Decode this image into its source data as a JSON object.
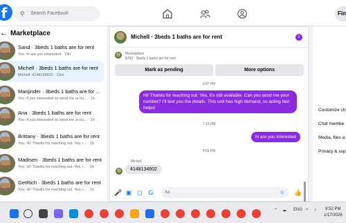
{
  "topbar": {
    "logo": "f",
    "search_placeholder": "Search Facebook",
    "icons": [
      "home-icon",
      "groups-icon",
      "profile-icon"
    ],
    "user": "Fin"
  },
  "left": {
    "title": "Marketplace",
    "conversations": [
      {
        "name": "Sand · 3beds 1 baths are for rent",
        "preview": "You: hi are you interested · 15h"
      },
      {
        "name": "Michell · 3beds 1 baths are for rent",
        "preview": "Michell: 4148134602 · 23m"
      },
      {
        "name": "Manjinder · 3beds 1 baths are for ...",
        "preview": "You: if you interested so send me ur nu... · 1h"
      },
      {
        "name": "Ana · 3beds 1 baths are for rent",
        "preview": "You: if you interested so send me ur nu... · 1h"
      },
      {
        "name": "Brittany · 3beds 1 baths are for rent",
        "preview": "You: Hi! Thanks for reaching out. Yes, i... · 1h"
      },
      {
        "name": "Madisen · 3beds 1 baths are for rent",
        "preview": "You: Hi! Thanks for reaching out. Yes, i... · 1h"
      },
      {
        "name": "GetRich · 3beds 1 baths are for rent",
        "preview": "You: Hi! Thanks for reaching out. Yes, i... · 1h"
      }
    ]
  },
  "chat": {
    "title": "Michell · 3beds 1 baths are for rent",
    "listing_type": "Marketplace",
    "listing_desc": "$750 · 3beds 1 baths are for rent",
    "btn_pending": "Mark as pending",
    "btn_more": "More options",
    "time1": "3:07 PM",
    "msg1": "Hi! Thanks for reaching out. Yes, it's still available. Can you send me your number? I'll text you the details. This unit has high demand, so acting fast helps!",
    "time2": "7:13 PM",
    "msg2": "hi are you interested",
    "time3": "9:03 PM",
    "sender": "Michell",
    "msg3": "4148134602",
    "input_placeholder": "Aa"
  },
  "right": {
    "items": [
      "Customize ch",
      "Chat membe",
      "Media, files a",
      "Privacy & sup"
    ]
  },
  "taskbar": {
    "lang": "ENG",
    "time": "9:52 PM",
    "date": "1/17/2026"
  }
}
